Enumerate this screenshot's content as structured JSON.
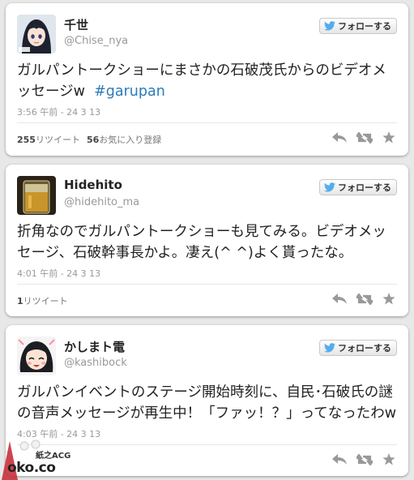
{
  "follow_label": "フォローする",
  "colors": {
    "hashtag": "#2b7bb9",
    "twitter_bird": "#55acee"
  },
  "tweets": [
    {
      "name": "千世",
      "handle": "@Chise_nya",
      "text": "ガルパントークショーにまさかの石破茂氏からのビデオメッセージw",
      "hashtag": "#garupan",
      "timestamp": "3:56 午前 - 24 3 13",
      "retweets_count": "255",
      "retweets_label": "リツイート",
      "favorites_count": "56",
      "favorites_label": "お気に入り登録"
    },
    {
      "name": "Hidehito",
      "handle": "@hidehito_ma",
      "text": "折角なのでガルパントークショーも見てみる。ビデオメッセージ、石破幹事長かよ。凄え(^ ^)よく貰ったな。",
      "hashtag": "",
      "timestamp": "4:01 午前 - 24 3 13",
      "retweets_count": "1",
      "retweets_label": "リツイート",
      "favorites_count": "",
      "favorites_label": ""
    },
    {
      "name": "かしまト電",
      "handle": "@kashibock",
      "text": "ガルパンイベントのステージ開始時刻に、自民･石破氏の謎の音声メッセージが再生中！「ファッ！？」ってなったわw",
      "hashtag": "",
      "timestamp": "4:03 午前 - 24 3 13",
      "retweets_count": "",
      "retweets_label": "",
      "favorites_count": "",
      "favorites_label": ""
    }
  ],
  "watermark": {
    "text": "oko.co",
    "sub": "紙之ACG"
  }
}
